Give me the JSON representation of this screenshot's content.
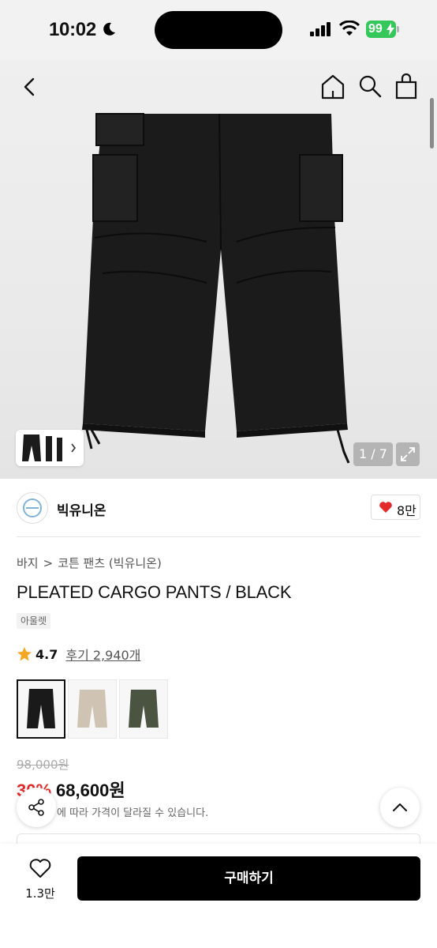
{
  "status_bar": {
    "time": "10:02",
    "battery": "99"
  },
  "gallery": {
    "counter": "1 / 7"
  },
  "brand": {
    "name": "빅유니온",
    "likes": "8만"
  },
  "breadcrumb": {
    "category": "바지",
    "separator": ">",
    "subcategory": "코튼 팬츠 (빅유니온)"
  },
  "product": {
    "title": "PLEATED CARGO PANTS / BLACK",
    "tag": "아울렛",
    "rating": "4.7",
    "reviews": "후기 2,940개",
    "color_options": [
      {
        "name": "black",
        "color": "#1a1a1a"
      },
      {
        "name": "beige",
        "color": "#cfc4b4"
      },
      {
        "name": "olive",
        "color": "#4a5440"
      }
    ]
  },
  "price": {
    "original": "98,000원",
    "discount": "30%",
    "sale": "68,600원",
    "note": "에 따라 가격이 달라질 수 있습니다."
  },
  "bottom": {
    "wish_count": "1.3만",
    "buy_label": "구매하기"
  },
  "colors": {
    "accent_red": "#e32b2b",
    "battery_green": "#34c759"
  }
}
